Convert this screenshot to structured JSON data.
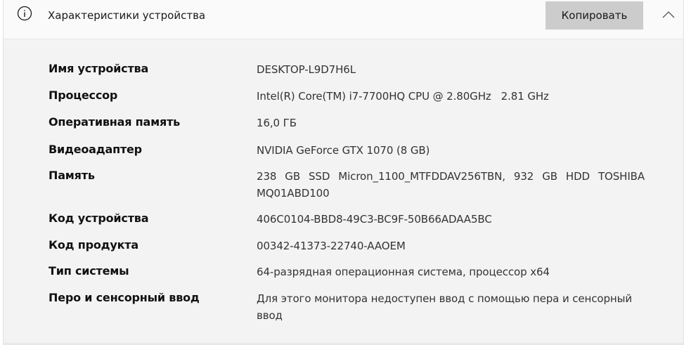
{
  "header": {
    "title": "Характеристики устройства",
    "copy_label": "Копировать"
  },
  "specs": [
    {
      "label": "Имя устройства",
      "value": "DESKTOP-L9D7H6L"
    },
    {
      "label": "Процессор",
      "value": "Intel(R) Core(TM) i7-7700HQ CPU @ 2.80GHz   2.81 GHz"
    },
    {
      "label": "Оперативная память",
      "value": "16,0 ГБ"
    },
    {
      "label": "Видеоадаптер",
      "value": "NVIDIA GeForce GTX 1070 (8 GB)"
    },
    {
      "label": "Память",
      "value": "238 GB SSD Micron_1100_MTFDDAV256TBN, 932 GB HDD TOSHIBA MQ01ABD100"
    },
    {
      "label": "Код устройства",
      "value": "406C0104-BBD8-49C3-BC9F-50B66ADAA5BC"
    },
    {
      "label": "Код продукта",
      "value": "00342-41373-22740-AAOEM"
    },
    {
      "label": "Тип системы",
      "value": "64-разрядная операционная система, процессор x64"
    },
    {
      "label": "Перо и сенсорный ввод",
      "value": "Для этого монитора недоступен ввод с помощью пера и сенсорный ввод"
    }
  ],
  "icons": {
    "info": "info-icon",
    "collapse": "chevron-up-icon"
  }
}
